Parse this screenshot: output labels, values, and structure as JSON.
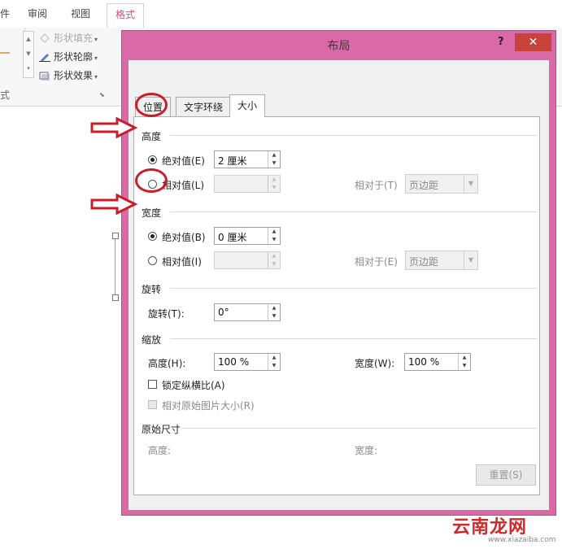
{
  "ribbon": {
    "tabs": [
      "件",
      "审阅",
      "视图",
      "格式"
    ],
    "shape_fill": "形状填充",
    "shape_outline": "形状轮廓",
    "shape_effects": "形状效果",
    "group_label": "式"
  },
  "dialog": {
    "title": "布局",
    "help": "?",
    "close": "✕",
    "tabs": [
      "位置",
      "文字环绕",
      "大小"
    ],
    "height": {
      "section": "高度",
      "absolute_label": "绝对值(E)",
      "absolute_value": "2 厘米",
      "relative_label": "相对值(L)",
      "relative_to_label": "相对于(T)",
      "relative_to_value": "页边距"
    },
    "width": {
      "section": "宽度",
      "absolute_label": "绝对值(B)",
      "absolute_value": "0 厘米",
      "relative_label": "相对值(I)",
      "relative_to_label": "相对于(E)",
      "relative_to_value": "页边距"
    },
    "rotation": {
      "section": "旋转",
      "label": "旋转(T):",
      "value": "0°"
    },
    "scale": {
      "section": "缩放",
      "height_label": "高度(H):",
      "height_value": "100 %",
      "width_label": "宽度(W):",
      "width_value": "100 %",
      "lock_ratio": "锁定纵横比(A)",
      "relative_original": "相对原始图片大小(R)"
    },
    "original": {
      "section": "原始尺寸",
      "height_label": "高度:",
      "width_label": "宽度:"
    },
    "reset": "重置(S)"
  },
  "watermark": {
    "text": "云南龙网",
    "url": "www.xiazaiba.com"
  },
  "colors": {
    "dialog_frame": "#d96aa7",
    "annotation_red": "#c81e2b"
  }
}
